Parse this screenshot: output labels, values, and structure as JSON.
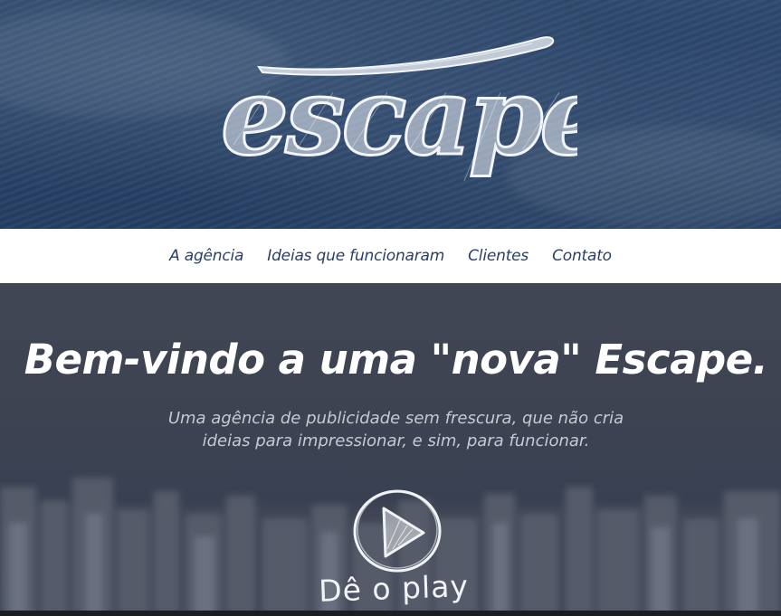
{
  "header": {
    "logo_text": "escape"
  },
  "nav": {
    "items": [
      {
        "label": "A agência"
      },
      {
        "label": "Ideias que funcionaram"
      },
      {
        "label": "Clientes"
      },
      {
        "label": "Contato"
      }
    ]
  },
  "hero": {
    "title": "Bem-vindo a uma \"nova\" Escape.",
    "subtitle_line1": "Uma agência de publicidade sem frescura, que não cria",
    "subtitle_line2": "ideias para impressionar, e sim, para funcionar.",
    "play_icon": "play-circle-icon",
    "play_label": "Dê o play"
  },
  "colors": {
    "header_bg": "#29446a",
    "nav_bg": "#ffffff",
    "nav_text": "#2a3f66",
    "hero_bg": "#3d4351",
    "hero_title": "#ffffff",
    "hero_subtitle": "#c6cad3"
  }
}
